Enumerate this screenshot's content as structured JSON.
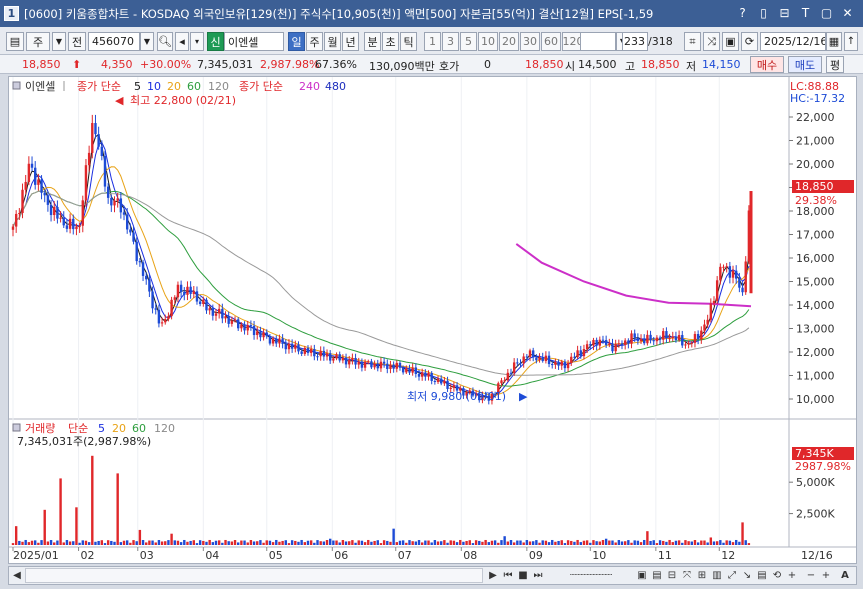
{
  "window": {
    "number": "1",
    "title": "[0600] 키움종합차트 - KOSDAQ 외국인보유[129(천)] 주식수[10,905(천)] 액면[500] 자본금[55(억)] 결산[12월] EPS[-1,59",
    "controls": [
      "?",
      "▯",
      "⊟",
      "T",
      "▢",
      "✕"
    ]
  },
  "toolbar": {
    "period_label": "주",
    "mode_label": "전",
    "code_value": "456070",
    "name_badge": "신",
    "stock_name": "이엔셀",
    "day_label": "일",
    "week_label": "주",
    "month_label": "월",
    "year_label": "년",
    "minute_label": "분",
    "second_label": "초",
    "tick_label": "틱",
    "intervals": [
      "1",
      "3",
      "5",
      "10",
      "20",
      "30",
      "60",
      "120"
    ],
    "count_value": "233",
    "count_total": "/318",
    "date_value": "2025/12/16"
  },
  "quote": {
    "price": "18,850",
    "change": "4,350",
    "change_pct": "+30.00%",
    "volume": "7,345,031",
    "volume_ratio": "2,987.98%",
    "turnover": "67.36%",
    "amount": "130,090백만",
    "bid_label": "호가",
    "bid_value": "0",
    "ask_value": "18,850",
    "open_label": "시",
    "open_value": "14,500",
    "high_label": "고",
    "high_value": "18,850",
    "low_label": "저",
    "low_value": "14,150",
    "buy_label": "매수",
    "sell_label": "매도",
    "eval_label": "평"
  },
  "price_legend": {
    "name": "이엔셀",
    "ma_label": "종가 단순",
    "periods": [
      "5",
      "10",
      "20",
      "60",
      "120"
    ],
    "ma2_label": "종가 단순",
    "ma2_periods": [
      "240",
      "480"
    ]
  },
  "volume_legend": {
    "name": "거래량",
    "ma_label": "단순",
    "periods": [
      "5",
      "20",
      "60",
      "120"
    ],
    "value_text": "7,345,031주(2,987.98%)"
  },
  "annotations": {
    "lc": "LC:88.88",
    "hc": "HC:-17.32",
    "max_label": "최고 22,800 (02/21)",
    "min_label": "최저 9,980 (09/01)",
    "price_tag": "18,850",
    "price_pct_tag": "29.38%",
    "vol_tag": "7,345K",
    "vol_pct_tag": "2987.98%"
  },
  "colors": {
    "up": "#e0272a",
    "down": "#1d4bd6",
    "ma5": "#1a1a1a",
    "ma10": "#1a2ee0",
    "ma20": "#e8a317",
    "ma60": "#2e9e3e",
    "ma120": "#9a9a9a",
    "ma240": "#cc2fc8"
  },
  "chart_data": {
    "type": "line",
    "ylim": [
      9000,
      23000
    ],
    "price_ticks": [
      "22,000",
      "21,000",
      "20,000",
      "19,000",
      "18,000",
      "17,000",
      "16,000",
      "15,000",
      "14,000",
      "13,000",
      "12,000",
      "11,000",
      "10,000"
    ],
    "volume_ticks": [
      "5,000K",
      "2,500K"
    ],
    "volume_ylim": [
      0,
      7800
    ],
    "x_labels": [
      "2025/01",
      "02",
      "03",
      "04",
      "05",
      "06",
      "07",
      "08",
      "09",
      "10",
      "11",
      "12",
      "12/16"
    ],
    "x_label_days": [
      0,
      31,
      59,
      90,
      120,
      151,
      181,
      212,
      243,
      273,
      304,
      334,
      349
    ],
    "close_series_days": [
      0,
      8,
      15,
      22,
      31,
      38,
      45,
      51,
      56,
      62,
      70,
      78,
      85,
      92,
      98,
      105,
      112,
      120,
      135,
      150,
      165,
      180,
      195,
      210,
      225,
      235,
      243,
      250,
      260,
      268,
      276,
      285,
      292,
      300,
      310,
      320,
      328,
      335,
      340,
      345,
      349
    ],
    "close_series": [
      17200,
      20000,
      18500,
      17600,
      17200,
      22000,
      18500,
      18200,
      16800,
      15200,
      13000,
      14700,
      14500,
      13800,
      13600,
      13200,
      13000,
      12600,
      12100,
      11800,
      11500,
      11400,
      11000,
      10400,
      10000,
      11200,
      11900,
      11700,
      11400,
      12000,
      12500,
      12200,
      12600,
      12500,
      12700,
      12300,
      13200,
      15700,
      15400,
      14500,
      18850
    ],
    "ma240_days": [
      238,
      250,
      270,
      290,
      310,
      330,
      349
    ],
    "ma240": [
      16600,
      15800,
      15000,
      14400,
      14100,
      14050,
      13950
    ],
    "volume_days": [
      2,
      15,
      22,
      30,
      38,
      50,
      60,
      75,
      100,
      150,
      180,
      232,
      280,
      300,
      330,
      345,
      349
    ],
    "volume_k": [
      1500,
      2800,
      5300,
      3000,
      7100,
      5700,
      1200,
      900,
      400,
      500,
      1300,
      700,
      500,
      1100,
      600,
      1800,
      7345
    ]
  }
}
